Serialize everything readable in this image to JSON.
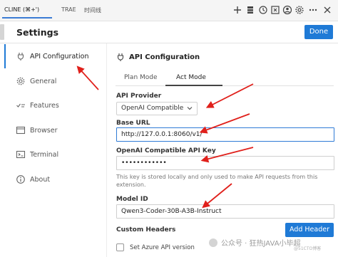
{
  "tabs": [
    "CLINE (⌘+')",
    "TRAE",
    "时间线"
  ],
  "header": {
    "title": "Settings",
    "done_label": "Done"
  },
  "sidebar": {
    "items": [
      {
        "label": "API Configuration",
        "icon": "plug-icon"
      },
      {
        "label": "General",
        "icon": "gear-icon"
      },
      {
        "label": "Features",
        "icon": "checklist-icon"
      },
      {
        "label": "Browser",
        "icon": "browser-icon"
      },
      {
        "label": "Terminal",
        "icon": "terminal-icon"
      },
      {
        "label": "About",
        "icon": "info-icon"
      }
    ]
  },
  "main": {
    "section_title": "API Configuration",
    "mode_tabs": [
      "Plan Mode",
      "Act Mode"
    ],
    "active_mode": "Act Mode",
    "api_provider": {
      "label": "API Provider",
      "value": "OpenAI Compatible"
    },
    "base_url": {
      "label": "Base URL",
      "value": "http://127.0.0.1:8060/v1/"
    },
    "api_key": {
      "label": "OpenAI Compatible API Key",
      "value": "••••••••••••",
      "help": "This key is stored locally and only used to make API requests from this extension."
    },
    "model_id": {
      "label": "Model ID",
      "value": "Qwen3-Coder-30B-A3B-Instruct"
    },
    "custom_headers": {
      "label": "Custom Headers",
      "add_label": "Add Header"
    },
    "azure_checkbox": {
      "label": "Set Azure API version",
      "checked": false
    }
  },
  "watermark": {
    "text": "公众号 · 狂热JAVA小毕超",
    "sub": "@51CTO博客"
  },
  "colors": {
    "accent": "#1f7ad6",
    "annotation": "#e0201b"
  }
}
